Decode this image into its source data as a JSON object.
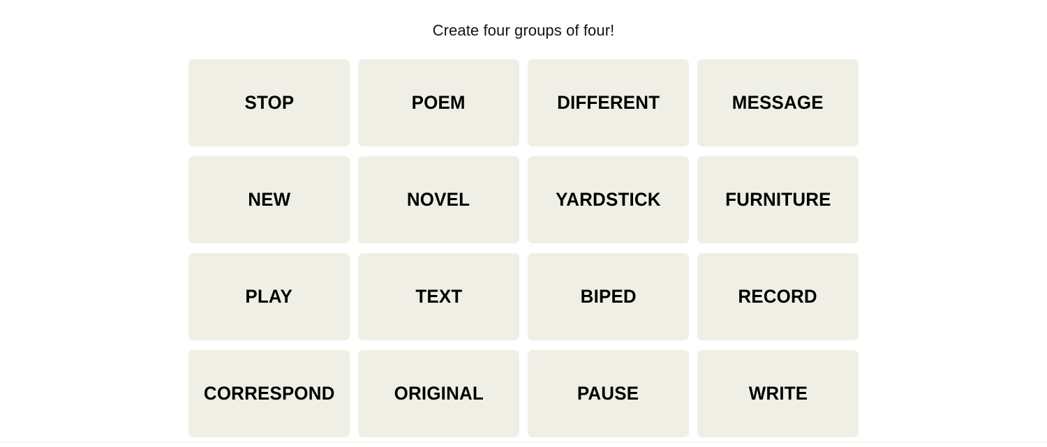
{
  "header": {
    "instruction": "Create four groups of four!"
  },
  "colors": {
    "page_background": "#ffffff",
    "tile_background": "#efefe6",
    "tile_text": "#000000",
    "title_text": "#121213",
    "divider": "#efefe9"
  },
  "board": {
    "rows": 4,
    "columns": 4,
    "tiles": [
      {
        "label": "STOP"
      },
      {
        "label": "POEM"
      },
      {
        "label": "DIFFERENT"
      },
      {
        "label": "MESSAGE"
      },
      {
        "label": "NEW"
      },
      {
        "label": "NOVEL"
      },
      {
        "label": "YARDSTICK"
      },
      {
        "label": "FURNITURE"
      },
      {
        "label": "PLAY"
      },
      {
        "label": "TEXT"
      },
      {
        "label": "BIPED"
      },
      {
        "label": "RECORD"
      },
      {
        "label": "CORRESPOND"
      },
      {
        "label": "ORIGINAL"
      },
      {
        "label": "PAUSE"
      },
      {
        "label": "WRITE"
      }
    ]
  }
}
